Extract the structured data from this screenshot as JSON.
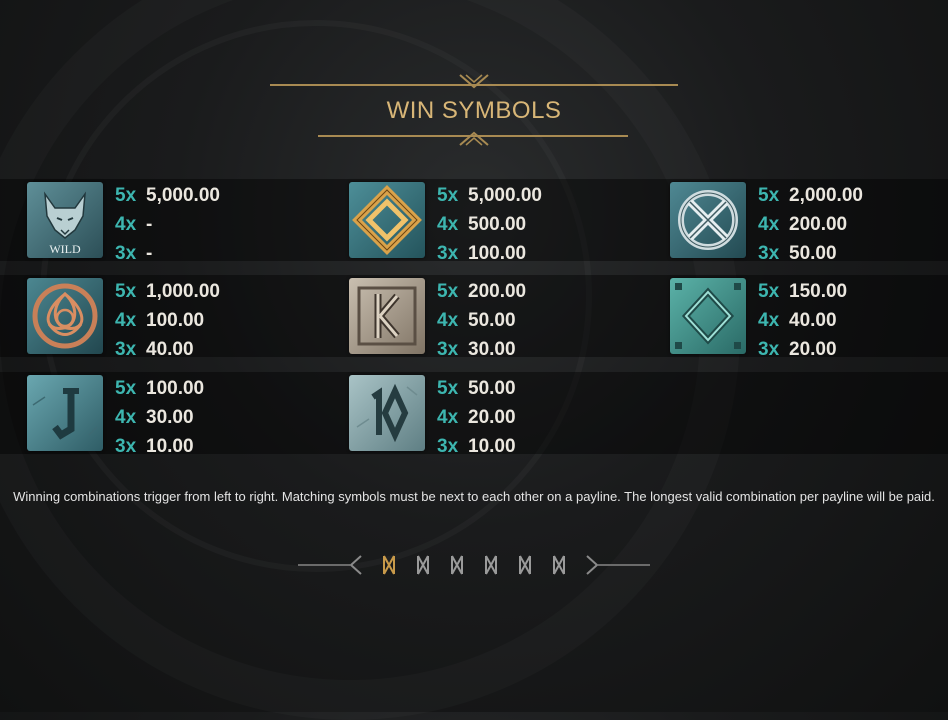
{
  "title": "WIN SYMBOLS",
  "symbols": [
    {
      "icon": "wolf-wild-icon",
      "label": "WILD",
      "pays": [
        {
          "mult": "5x",
          "amount": "5,000.00"
        },
        {
          "mult": "4x",
          "amount": "-"
        },
        {
          "mult": "3x",
          "amount": "-"
        }
      ]
    },
    {
      "icon": "gold-diamond-knot-icon",
      "pays": [
        {
          "mult": "5x",
          "amount": "5,000.00"
        },
        {
          "mult": "4x",
          "amount": "500.00"
        },
        {
          "mult": "3x",
          "amount": "100.00"
        }
      ]
    },
    {
      "icon": "silver-circle-knot-icon",
      "pays": [
        {
          "mult": "5x",
          "amount": "2,000.00"
        },
        {
          "mult": "4x",
          "amount": "200.00"
        },
        {
          "mult": "3x",
          "amount": "50.00"
        }
      ]
    },
    {
      "icon": "copper-triquetra-icon",
      "pays": [
        {
          "mult": "5x",
          "amount": "1,000.00"
        },
        {
          "mult": "4x",
          "amount": "100.00"
        },
        {
          "mult": "3x",
          "amount": "40.00"
        }
      ]
    },
    {
      "icon": "stone-k-rune-icon",
      "pays": [
        {
          "mult": "5x",
          "amount": "200.00"
        },
        {
          "mult": "4x",
          "amount": "50.00"
        },
        {
          "mult": "3x",
          "amount": "30.00"
        }
      ]
    },
    {
      "icon": "teal-diamond-rune-icon",
      "pays": [
        {
          "mult": "5x",
          "amount": "150.00"
        },
        {
          "mult": "4x",
          "amount": "40.00"
        },
        {
          "mult": "3x",
          "amount": "20.00"
        }
      ]
    },
    {
      "icon": "j-rune-icon",
      "pays": [
        {
          "mult": "5x",
          "amount": "100.00"
        },
        {
          "mult": "4x",
          "amount": "30.00"
        },
        {
          "mult": "3x",
          "amount": "10.00"
        }
      ]
    },
    {
      "icon": "ten-rune-icon",
      "pays": [
        {
          "mult": "5x",
          "amount": "50.00"
        },
        {
          "mult": "4x",
          "amount": "20.00"
        },
        {
          "mult": "3x",
          "amount": "10.00"
        }
      ]
    }
  ],
  "description": "Winning combinations trigger from left to right. Matching symbols must be next to each other on a payline. The longest valid combination per payline will be paid.",
  "pagination": {
    "total_pages": 6,
    "current_page": 1
  },
  "colors": {
    "gold": "#d8b677",
    "multiplier": "#3db6b0",
    "amount": "#ebe7df",
    "page_active": "#c89a4a",
    "page_inactive": "#9a9a9a"
  }
}
